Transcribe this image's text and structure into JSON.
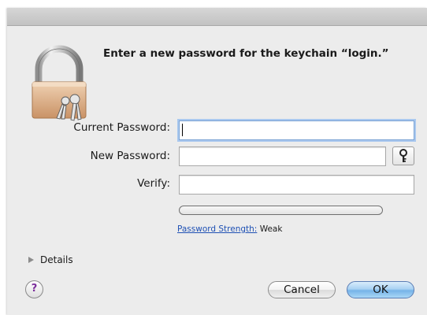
{
  "dialog": {
    "prompt": "Enter a new password for the keychain “login.”",
    "lock_icon": "padlock-with-keys-icon"
  },
  "fields": {
    "current_password": {
      "label": "Current Password:",
      "value": ""
    },
    "new_password": {
      "label": "New Password:",
      "value": ""
    },
    "verify": {
      "label": "Verify:",
      "value": ""
    }
  },
  "key_button": {
    "icon": "key-icon"
  },
  "strength": {
    "link_label": "Password Strength:",
    "value": "Weak",
    "level": 0
  },
  "details": {
    "label": "Details",
    "icon": "disclosure-triangle-icon"
  },
  "help": {
    "label": "?"
  },
  "buttons": {
    "cancel": "Cancel",
    "ok": "OK"
  },
  "colors": {
    "dialog_bg": "#ececec",
    "focus_ring": "#a9c8ef",
    "default_button": "#76b3e8",
    "link": "#1e50b4"
  }
}
